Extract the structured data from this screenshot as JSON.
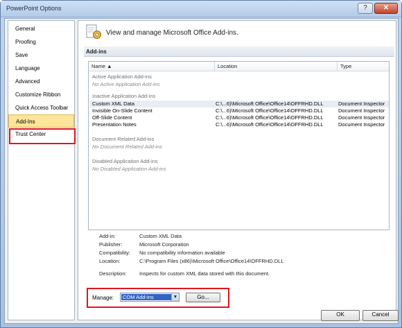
{
  "window": {
    "title": "PowerPoint Options"
  },
  "nav": {
    "items": [
      {
        "label": "General"
      },
      {
        "label": "Proofing"
      },
      {
        "label": "Save"
      },
      {
        "label": "Language"
      },
      {
        "label": "Advanced"
      },
      {
        "label": "Customize Ribbon"
      },
      {
        "label": "Quick Access Toolbar"
      },
      {
        "label": "Add-Ins"
      },
      {
        "label": "Trust Center"
      }
    ],
    "selected": "Add-Ins"
  },
  "main": {
    "header": "View and manage Microsoft Office Add-ins.",
    "section_title": "Add-ins",
    "columns": {
      "name": "Name ▲",
      "location": "Location",
      "type": "Type"
    },
    "groups": {
      "active": {
        "title": "Active Application Add-ins",
        "note": "No Active Application Add-ins"
      },
      "inactive": {
        "title": "Inactive Application Add-ins"
      },
      "document": {
        "title": "Document Related Add-ins",
        "note": "No Document Related Add-ins"
      },
      "disabled": {
        "title": "Disabled Application Add-ins",
        "note": "No Disabled Application Add-ins"
      }
    },
    "rows": [
      {
        "name": "Custom XML Data",
        "location": "C:\\...6)\\Microsoft Office\\Office14\\OFFRHD.DLL",
        "type": "Document Inspector"
      },
      {
        "name": "Invisible On-Slide Content",
        "location": "C:\\...6)\\Microsoft Office\\Office14\\OFFRHD.DLL",
        "type": "Document Inspector"
      },
      {
        "name": "Off-Slide Content",
        "location": "C:\\...6)\\Microsoft Office\\Office14\\OFFRHD.DLL",
        "type": "Document Inspector"
      },
      {
        "name": "Presentation Notes",
        "location": "C:\\...6)\\Microsoft Office\\Office14\\OFFRHD.DLL",
        "type": "Document Inspector"
      }
    ],
    "details": {
      "addin_label": "Add-in:",
      "addin": "Custom XML Data",
      "publisher_label": "Publisher:",
      "publisher": "Microsoft Corporation",
      "compat_label": "Compatibility:",
      "compat": "No compatibility information available",
      "location_label": "Location:",
      "location": "C:\\Program Files (x86)\\Microsoft Office\\Office14\\OFFRHD.DLL",
      "description_label": "Description:",
      "description": "Inspects for custom XML data stored with this document."
    },
    "manage": {
      "label": "Manage:",
      "selected": "COM Add-ins",
      "go": "Go..."
    }
  },
  "footer": {
    "ok": "OK",
    "cancel": "Cancel"
  },
  "colors": {
    "accent_highlight": "#e0141d",
    "selection": "#fde59a",
    "dropdown_selected": "#3163c5"
  }
}
